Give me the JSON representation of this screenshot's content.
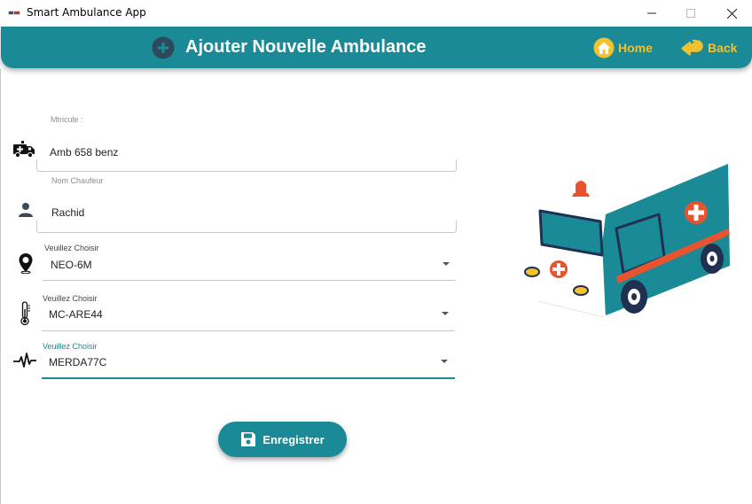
{
  "window": {
    "title": "Smart Ambulance App"
  },
  "header": {
    "title": "Ajouter Nouvelle Ambulance",
    "home_label": "Home",
    "back_label": "Back"
  },
  "form": {
    "matricule": {
      "label": "Mtricule :",
      "value": "Amb 658 benz"
    },
    "chauffeur": {
      "label": "Nom Chaufeur",
      "value": "Rachid"
    },
    "gps": {
      "label": "Veuillez Choisir",
      "value": "NEO-6M"
    },
    "temperature": {
      "label": "Veuillez Choisir",
      "value": "MC-ARE44"
    },
    "heart": {
      "label": "Veuillez Choisir",
      "value": "MERDA77C"
    }
  },
  "save_button": {
    "label": "Enregistrer"
  },
  "colors": {
    "primary": "#198a96",
    "accent": "#f2c12e",
    "cross": "#e8542f"
  }
}
